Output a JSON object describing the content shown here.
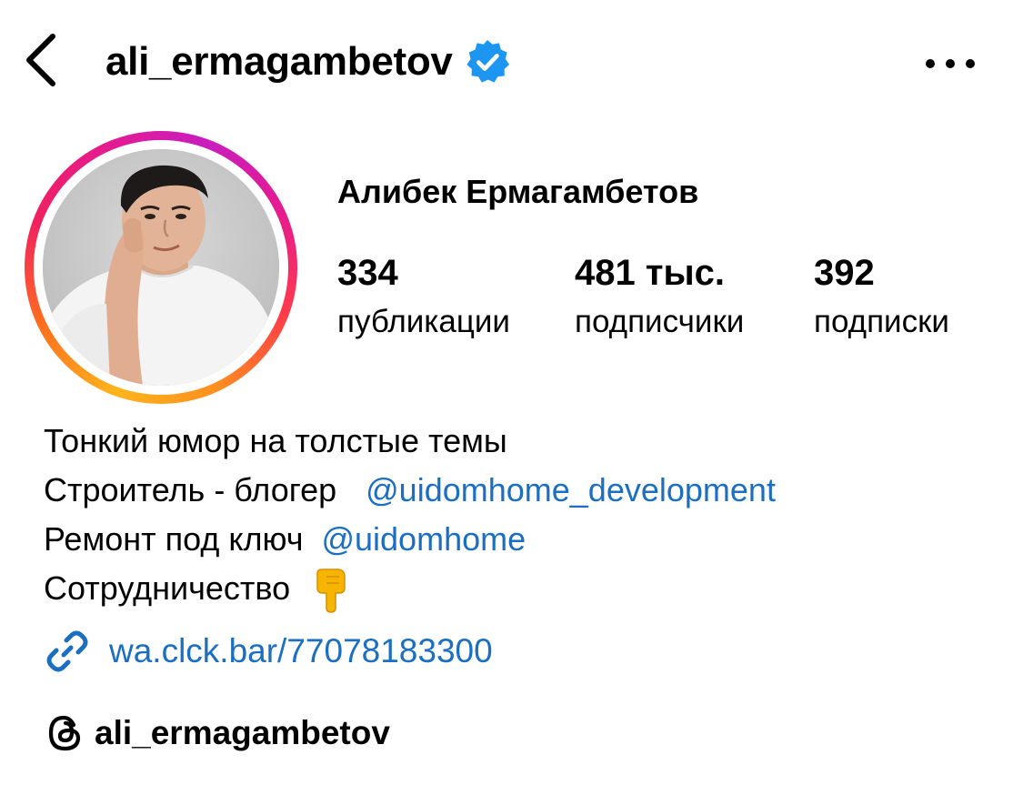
{
  "header": {
    "username": "ali_ermagambetov",
    "verified": true,
    "back_icon": "chevron-left-icon",
    "more_icon": "more-horizontal-icon"
  },
  "profile": {
    "full_name": "Алибек Ермагамбетов",
    "stats": [
      {
        "value": "334",
        "label": "публикации"
      },
      {
        "value": "481 тыс.",
        "label": "подписчики"
      },
      {
        "value": "392",
        "label": "подписки"
      }
    ]
  },
  "bio": {
    "line1": "Тонкий юмор на толстые темы",
    "line2_text": "Строитель - блогер",
    "line2_mention": "@uidomhome_development",
    "line3_text": "Ремонт под ключ",
    "line3_mention": "@uidomhome",
    "line4_text": "Сотрудничество",
    "line4_emoji": "pointing-down-hand-emoji"
  },
  "link": {
    "icon": "link-icon",
    "url": "wa.clck.bar/77078183300"
  },
  "threads": {
    "icon": "threads-icon",
    "username": "ali_ermagambetov"
  },
  "colors": {
    "link_blue": "#1b6fc2",
    "verified_blue": "#1c96f0",
    "ring_start": "#fdb51b",
    "ring_end": "#c91dbf"
  }
}
